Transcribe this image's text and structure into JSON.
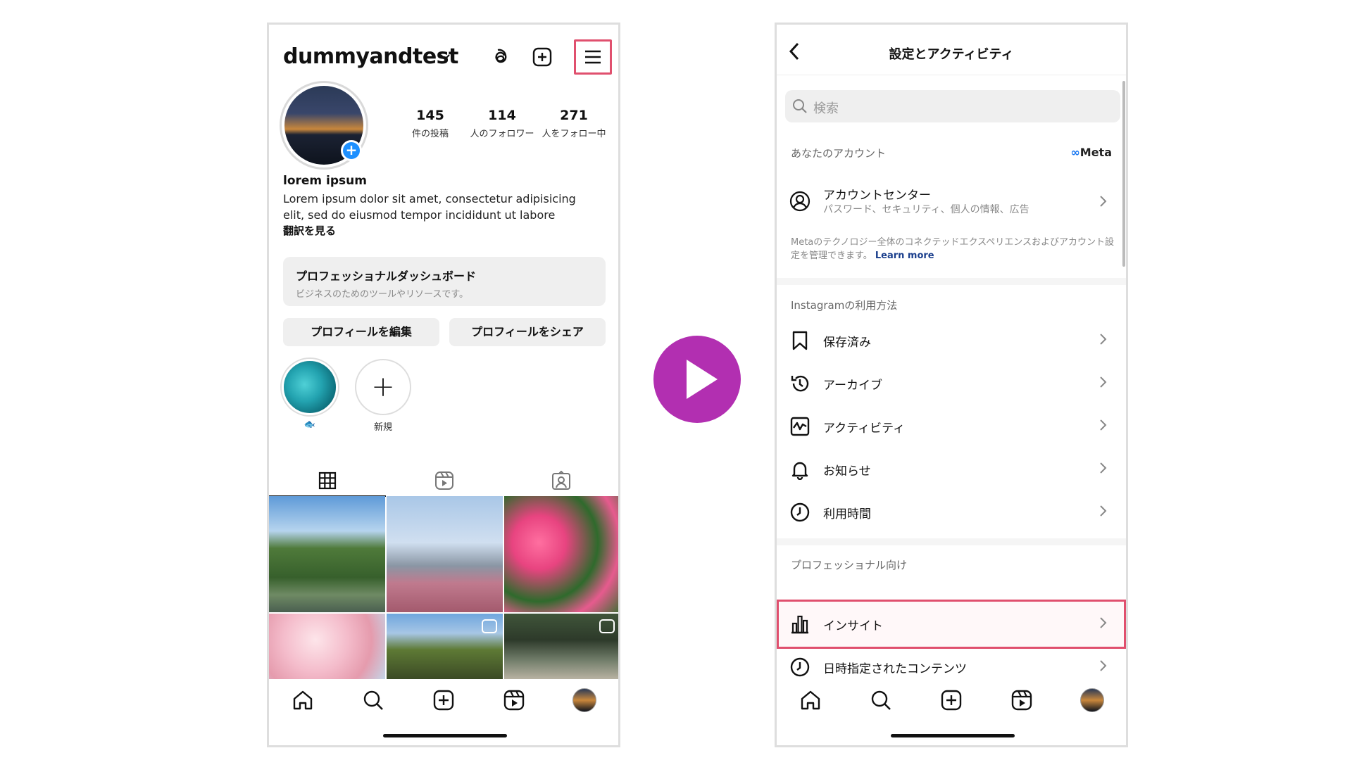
{
  "left_phone": {
    "username": "dummyandtest",
    "stats": [
      {
        "value": "145",
        "label": "件の投稿"
      },
      {
        "value": "114",
        "label": "人のフォロワー"
      },
      {
        "value": "271",
        "label": "人をフォロー中"
      }
    ],
    "bio": {
      "name": "lorem ipsum",
      "text": "Lorem ipsum dolor sit amet, consectetur adipisicing elit, sed do eiusmod tempor incididunt ut labore",
      "translate": "翻訳を見る"
    },
    "dashboard": {
      "title": "プロフェッショナルダッシュボード",
      "subtitle": "ビジネスのためのツールやリソースです。"
    },
    "buttons": {
      "edit": "プロフィールを編集",
      "share": "プロフィールをシェア"
    },
    "stories": [
      {
        "label": "🐟"
      },
      {
        "label": "新規"
      }
    ]
  },
  "right_phone": {
    "title": "設定とアクティビティ",
    "search_placeholder": "検索",
    "sections": {
      "account": "あなたのアカウント",
      "usage": "Instagramの利用方法",
      "professional": "プロフェッショナル向け"
    },
    "meta_brand": "Meta",
    "account_center": {
      "title": "アカウントセンター",
      "subtitle": "パスワード、セキュリティ、個人の情報、広告",
      "description": "Metaのテクノロジー全体のコネクテッドエクスペリエンスおよびアカウント設定を管理できます。",
      "learn_more": "Learn more"
    },
    "usage_items": [
      {
        "label": "保存済み",
        "icon": "bookmark-icon"
      },
      {
        "label": "アーカイブ",
        "icon": "archive-icon"
      },
      {
        "label": "アクティビティ",
        "icon": "activity-icon"
      },
      {
        "label": "お知らせ",
        "icon": "bell-icon"
      },
      {
        "label": "利用時間",
        "icon": "clock-icon"
      }
    ],
    "professional_items": [
      {
        "label": "インサイト",
        "icon": "bar-chart-icon"
      },
      {
        "label": "日時指定されたコンテンツ",
        "icon": "clock-icon"
      }
    ]
  },
  "colors": {
    "highlight": "#e0506e",
    "play_button": "#b22fb1",
    "plus_badge": "#1e90ff",
    "meta_blue": "#1877f2"
  }
}
